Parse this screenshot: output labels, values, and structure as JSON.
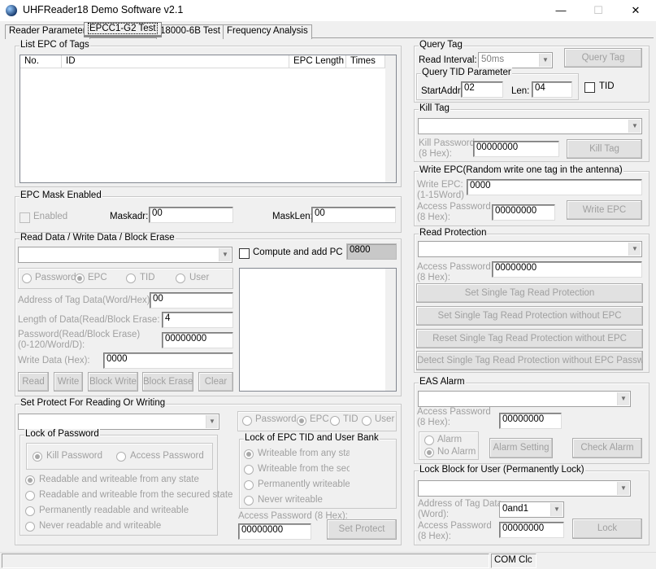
{
  "window": {
    "title": "UHFReader18 Demo Software v2.1",
    "min": "—",
    "max": "☐",
    "close": "✕"
  },
  "tabs": [
    "Reader Parameter",
    "EPCC1-G2 Test",
    "18000-6B Test",
    "Frequency Analysis"
  ],
  "list_epc": {
    "legend": "List EPC of Tags",
    "columns": [
      "No.",
      "ID",
      "EPC Length",
      "Times"
    ]
  },
  "epc_mask": {
    "legend": "EPC Mask Enabled",
    "enabled": "Enabled",
    "maskadr_label": "Maskadr:",
    "maskadr": "00",
    "masklen_label": "MaskLen:",
    "masklen": "00"
  },
  "rw": {
    "legend": "Read Data / Write Data / Block Erase",
    "compute": "Compute and add PC",
    "pc_value": "0800",
    "mem": [
      "Password",
      "EPC",
      "TID",
      "User"
    ],
    "addr_label": "Address of Tag Data(Word/Hex):",
    "addr": "00",
    "len_label": "Length of Data(Read/Block Erase:",
    "len": "4",
    "pwd_label1": "Password(Read/Block Erase)",
    "pwd_label2": "(0-120/Word/D):",
    "pwd": "00000000",
    "write_label": "Write Data (Hex):",
    "write": "0000",
    "buttons": [
      "Read",
      "Write",
      "Block Write",
      "Block Erase",
      "Clear"
    ]
  },
  "protect": {
    "legend": "Set Protect For Reading Or Writing",
    "lock_pwd_legend": "Lock of Password",
    "kill_pwd": "Kill Password",
    "access_pwd": "Access Password",
    "pwd_options": [
      "Readable and  writeable from any state",
      "Readable and writeable from the secured state",
      "Permanently readable and writeable",
      "Never readable and writeable"
    ],
    "mem": [
      "Password",
      "EPC",
      "TID",
      "User"
    ],
    "lock_epc_legend": "Lock of EPC TID and User Bank",
    "epc_options": [
      "Writeable from any state",
      "Writeable from the secured state",
      "Permanently writeable",
      "Never writeable"
    ],
    "access_label": "Access Password (8 Hex):",
    "access": "00000000",
    "set_btn": "Set Protect"
  },
  "query": {
    "legend": "Query Tag",
    "interval_label": "Read Interval:",
    "interval": "50ms",
    "btn": "Query Tag",
    "tid_legend": "Query TID Parameter",
    "start_label": "StartAddr:",
    "start": "02",
    "len_label": "Len:",
    "len": "04",
    "tid": "TID"
  },
  "kill": {
    "legend": "Kill Tag",
    "pwd_label1": "Kill Password",
    "pwd_label2": "(8 Hex):",
    "pwd": "00000000",
    "btn": "Kill Tag"
  },
  "write_epc": {
    "legend": "Write EPC(Random write one tag in the antenna)",
    "epc_label1": "Write EPC:",
    "epc_label2": "(1-15Word)",
    "epc": "0000",
    "pwd_label1": "Access Password",
    "pwd_label2": "(8 Hex):",
    "pwd": "00000000",
    "btn": "Write EPC"
  },
  "read_prot": {
    "legend": "Read Protection",
    "pwd_label1": "Access Password",
    "pwd_label2": "(8 Hex):",
    "pwd": "00000000",
    "buttons": [
      "Set Single Tag Read Protection",
      "Set Single Tag Read Protection without EPC",
      "Reset Single Tag Read Protection without EPC",
      "Detect Single Tag Read Protection without EPC Password"
    ]
  },
  "eas": {
    "legend": "EAS Alarm",
    "pwd_label1": "Access Password",
    "pwd_label2": "(8 Hex):",
    "pwd": "00000000",
    "alarm": "Alarm",
    "no_alarm": "No Alarm",
    "set_btn": "Alarm Setting",
    "check_btn": "Check Alarm"
  },
  "lock_block": {
    "legend": "Lock Block for User (Permanently Lock)",
    "addr_label1": "Address of Tag Data",
    "addr_label2": "(Word):",
    "addr": "0and1",
    "pwd_label1": "Access Password",
    "pwd_label2": "(8 Hex):",
    "pwd": "00000000",
    "btn": "Lock"
  },
  "status": {
    "com": "COM Clc"
  }
}
